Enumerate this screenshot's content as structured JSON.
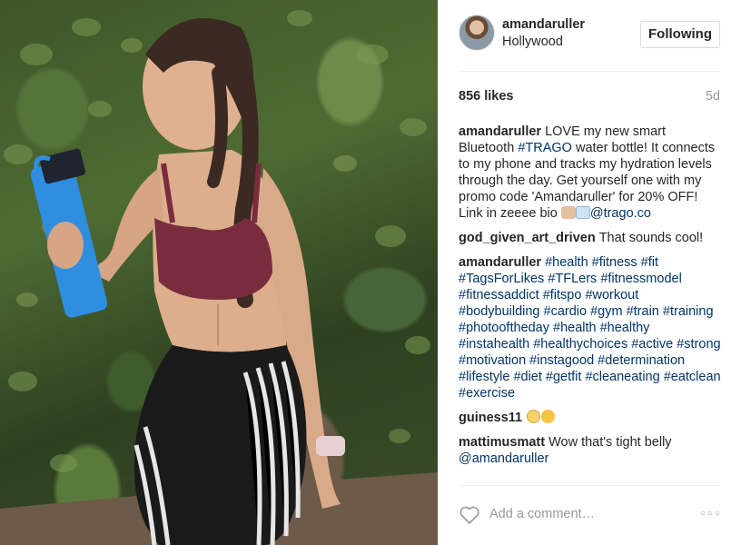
{
  "post": {
    "username": "amandaruller",
    "location": "Hollywood",
    "follow_label": "Following",
    "likes": "856 likes",
    "time_ago": "5d"
  },
  "caption": {
    "author": "amandaruller",
    "text_1": "LOVE my new smart Bluetooth ",
    "hashtag": "#TRAGO",
    "text_2": " water bottle! It connects to my phone and tracks my hydration levels through the day. Get yourself one with my promo code 'Amandaruller' for 20% OFF! Link in zeeee bio ",
    "emojis": [
      "flexed-biceps",
      "water-droplets"
    ],
    "mention": "@trago.co"
  },
  "comments": [
    {
      "author": "god_given_art_driven",
      "text": "That sounds cool!"
    },
    {
      "author": "amandaruller",
      "text": "#health #fitness #fit #TagsForLikes #TFLers #fitnessmodel #fitnessaddict #fitspo #workout #bodybuilding #cardio #gym #train #training #photooftheday #health #healthy #instahealth #healthychoices #active #strong #motivation #instagood #determination #lifestyle #diet #getfit #cleaneating #eatclean #exercise"
    },
    {
      "author": "guiness11",
      "text": "",
      "emojis": [
        "screaming-face",
        "heart-eyes-face"
      ]
    },
    {
      "author": "mattimusmatt",
      "text": "Wow that's tight belly ",
      "mention": "@amandaruller"
    }
  ],
  "footer": {
    "comment_placeholder": "Add a comment…",
    "like_icon": "heart-outline-icon",
    "more_icon": "ellipsis-icon"
  },
  "colors": {
    "text": "#262626",
    "link": "#003569",
    "muted": "#999999",
    "bottle": "#2f8ee0"
  }
}
